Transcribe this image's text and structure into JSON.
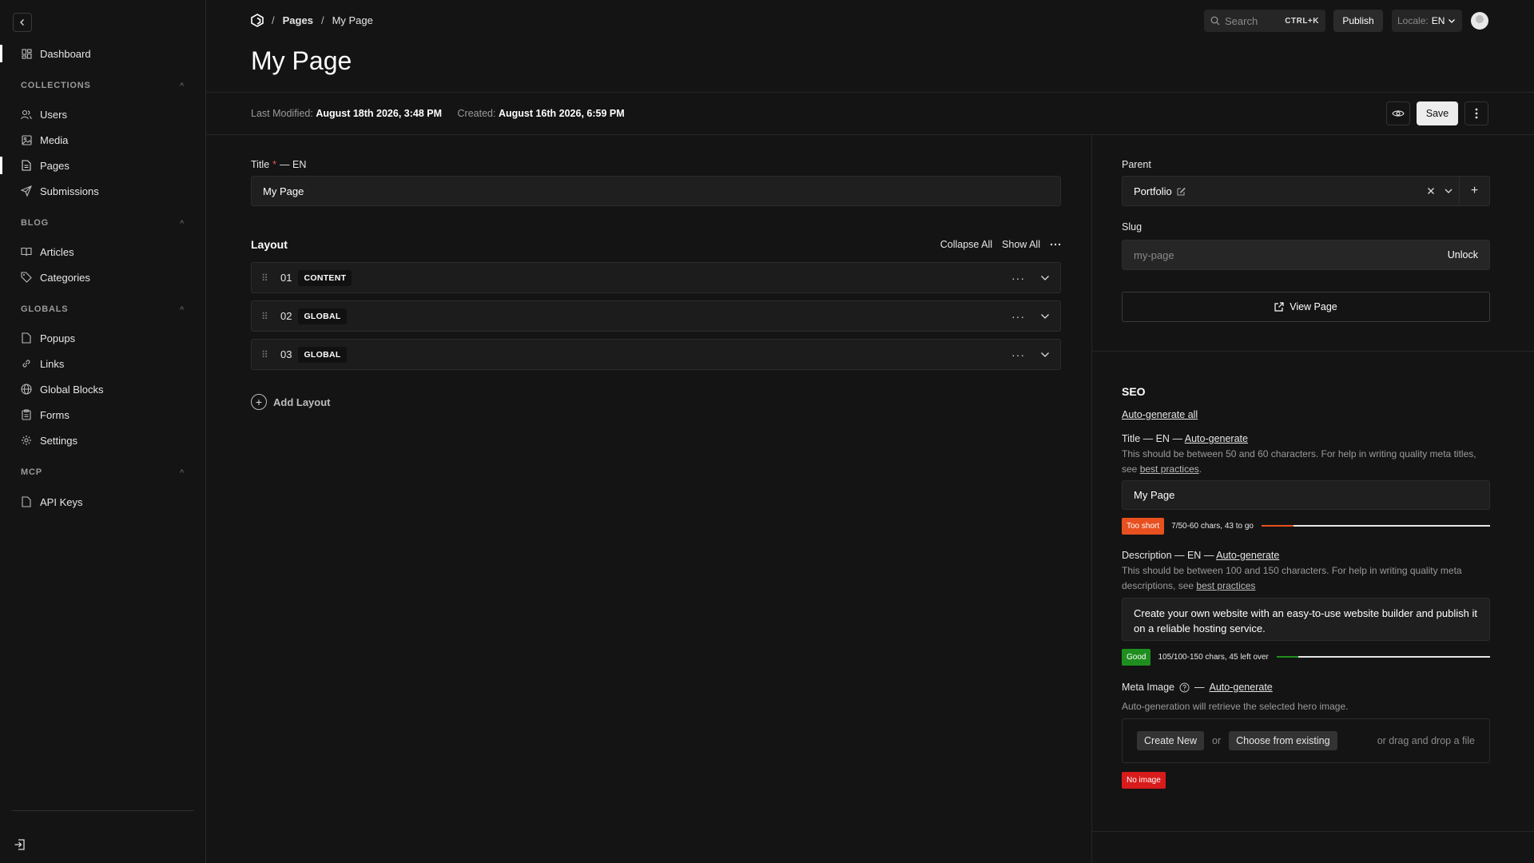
{
  "sidebar": {
    "dashboard": "Dashboard",
    "groups": [
      {
        "label": "COLLECTIONS",
        "items": [
          "Users",
          "Media",
          "Pages",
          "Submissions"
        ]
      },
      {
        "label": "BLOG",
        "items": [
          "Articles",
          "Categories"
        ]
      },
      {
        "label": "GLOBALS",
        "items": [
          "Popups",
          "Links",
          "Global Blocks",
          "Forms",
          "Settings"
        ]
      },
      {
        "label": "MCP",
        "items": [
          "API Keys"
        ]
      }
    ],
    "active_item": "Pages"
  },
  "breadcrumb": {
    "sep": "/",
    "section": "Pages",
    "current": "My Page"
  },
  "header": {
    "title": "My Page",
    "search_placeholder": "Search",
    "search_shortcut": "CTRL+K",
    "publish_label": "Publish",
    "locale_label": "Locale:",
    "locale_value": "EN"
  },
  "status": {
    "modified_label": "Last Modified:",
    "modified_value": "August 18th 2026, 3:48 PM",
    "created_label": "Created:",
    "created_value": "August 16th 2026, 6:59 PM",
    "save_label": "Save"
  },
  "main": {
    "title_label": "Title",
    "title_required": "*",
    "title_locale": "— EN",
    "title_value": "My Page",
    "layout": {
      "heading": "Layout",
      "collapse_all": "Collapse All",
      "show_all": "Show All",
      "rows": [
        {
          "num": "01",
          "type": "CONTENT"
        },
        {
          "num": "02",
          "type": "GLOBAL"
        },
        {
          "num": "03",
          "type": "GLOBAL"
        }
      ],
      "add_label": "Add Layout"
    }
  },
  "aside": {
    "parent_label": "Parent",
    "parent_value": "Portfolio",
    "slug_label": "Slug",
    "slug_value": "my-page",
    "unlock_label": "Unlock",
    "view_page_label": "View Page",
    "seo": {
      "heading": "SEO",
      "auto_all": "Auto-generate all",
      "auto": "Auto-generate",
      "title_label": "Title — EN",
      "title_help": "This should be between 50 and 60 characters. For help in writing quality meta titles, see",
      "best_practices": "best practices",
      "title_value": "My Page",
      "title_badge": "Too short",
      "title_meter": "7/50-60 chars, 43 to go",
      "title_progress": 0.14,
      "desc_label": "Description — EN",
      "desc_help": "This should be between 100 and 150 characters. For help in writing quality meta descriptions, see",
      "desc_value": "Create your own website with an easy-to-use website builder and publish it on a reliable hosting service.",
      "desc_badge": "Good",
      "desc_meter": "105/100-150 chars, 45 left over",
      "desc_progress": 0.1,
      "meta_image_label": "Meta Image",
      "meta_image_help": "Auto-generation will retrieve the selected hero image.",
      "create_new": "Create New",
      "or": "or",
      "choose_existing": "Choose from existing",
      "drag_drop": "or drag and drop a file",
      "no_image": "No image"
    }
  },
  "colors": {
    "too_short": "#e8501f",
    "good": "#1e8f1e",
    "no_image": "#d81b1b"
  }
}
